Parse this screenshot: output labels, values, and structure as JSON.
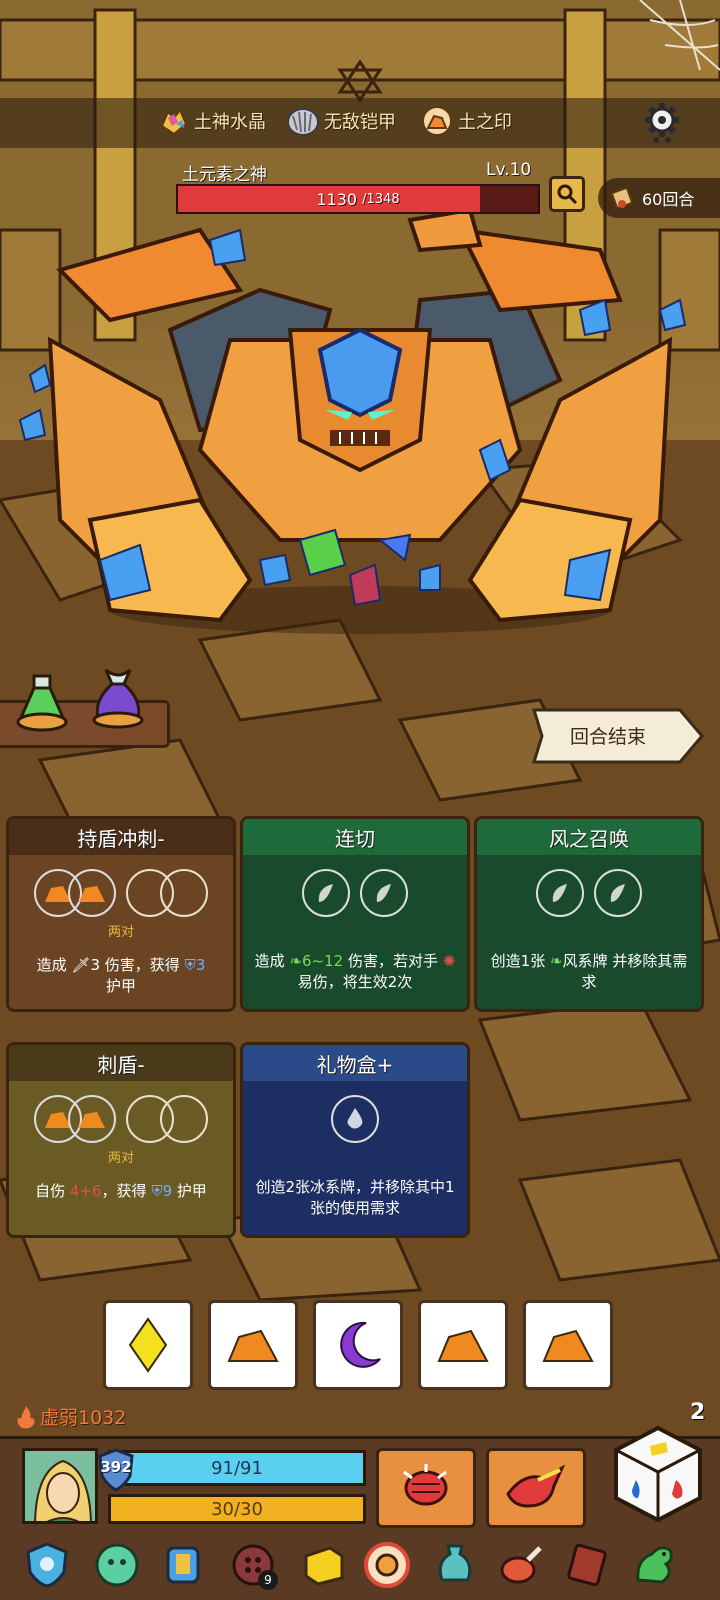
{
  "resources": [
    {
      "icon": "earth-crystal-icon",
      "label": "土神水晶"
    },
    {
      "icon": "invincible-armor-icon",
      "label": "无敌铠甲"
    },
    {
      "icon": "earth-seal-icon",
      "label": "土之印"
    }
  ],
  "boss": {
    "name": "土元素之神",
    "level": "Lv.10",
    "hp_current": "1130",
    "hp_max": "/1348",
    "hp_fraction": 0.838
  },
  "turns": "60回合",
  "end_turn_label": "回合结束",
  "cards": [
    {
      "title": "持盾冲刺-",
      "pair_label": "两对",
      "desc_parts": [
        "造成 ",
        "3",
        " 伤害，获得 ",
        "3",
        "护甲"
      ],
      "color": "brown"
    },
    {
      "title": "连切",
      "desc_parts": [
        "造成 ",
        "6~12",
        " 伤害，若对手 ",
        "易伤，将生效2次"
      ],
      "color": "green"
    },
    {
      "title": "风之召唤",
      "desc_parts": [
        "创造1张 ",
        "风系牌 并移除其需求"
      ],
      "color": "green"
    },
    {
      "title": "刺盾-",
      "pair_label": "两对",
      "desc_parts": [
        "自伤 ",
        "4+6",
        "，获得 ",
        "9",
        " 护甲"
      ],
      "color": "olive"
    },
    {
      "title": "礼物盒+",
      "desc_parts": [
        "创造2张冰系牌，并移除其中1张的使用需求"
      ],
      "color": "blue"
    }
  ],
  "dice": [
    "diamond",
    "earth",
    "moon",
    "earth",
    "earth"
  ],
  "weak_status": "虚弱1032",
  "dice_count": "2",
  "player": {
    "shield": "392",
    "hp": "91/91",
    "energy": "30/30"
  },
  "relic_count": "9",
  "colors": {
    "hp_red": "#e03a3a",
    "player_hp": "#5ad0f0",
    "energy": "#f0b020",
    "earth_orange": "#f08a20"
  }
}
